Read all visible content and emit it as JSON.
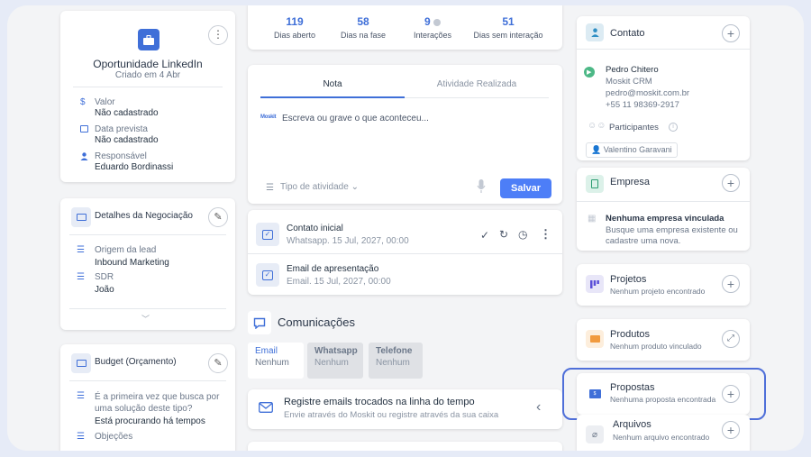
{
  "left": {
    "title": "Oportunidade LinkedIn",
    "created": "Criado em 4 Abr",
    "fields": [
      {
        "icon": "dollar-icon",
        "label": "Valor",
        "value": "Não cadastrado"
      },
      {
        "icon": "calendar-icon",
        "label": "Data prevista",
        "value": "Não cadastrado"
      },
      {
        "icon": "user-icon",
        "label": "Responsável",
        "value": "Eduardo Bordinassi"
      }
    ],
    "details": {
      "title": "Detalhes da Negociação",
      "rows": [
        {
          "label": "Origem da lead",
          "value": "Inbound Marketing"
        },
        {
          "label": "SDR",
          "value": "João"
        }
      ]
    },
    "budget": {
      "title": "Budget (Orçamento)",
      "q1": "É a primeira vez que busca por uma solução deste tipo?",
      "a1": "Está procurando há tempos",
      "q2": "Objeções"
    }
  },
  "stats": [
    {
      "value": "119",
      "label": "Dias aberto"
    },
    {
      "value": "58",
      "label": "Dias na fase"
    },
    {
      "value": "9",
      "label": "Interações"
    },
    {
      "value": "51",
      "label": "Dias sem interação"
    }
  ],
  "note": {
    "tab_note": "Nota",
    "tab_activity": "Atividade Realizada",
    "logo_text": "Moskit",
    "placeholder": "Escreva ou grave o que aconteceu...",
    "activity_type": "Tipo de atividade",
    "save": "Salvar"
  },
  "activities": [
    {
      "title": "Contato inicial",
      "sub": "Whatsapp. 15 Jul, 2027, 00:00"
    },
    {
      "title": "Email de apresentação",
      "sub": "Email. 15 Jul, 2027, 00:00"
    }
  ],
  "comms": {
    "title": "Comunicações",
    "tabs": [
      {
        "name": "Email",
        "value": "Nenhum"
      },
      {
        "name": "Whatsapp",
        "value": "Nenhum"
      },
      {
        "name": "Telefone",
        "value": "Nenhum"
      }
    ],
    "email_title": "Registre emails trocados na linha do tempo",
    "email_sub": "Envie através do Moskit ou registre através da sua caixa"
  },
  "right": {
    "contact": {
      "title": "Contato",
      "name": "Pedro Chitero",
      "company": "Moskit CRM",
      "email": "pedro@moskit.com.br",
      "phone": "+55 11 98369-2917",
      "participants": "Participantes",
      "participant": "Valentino Garavani"
    },
    "company": {
      "title": "Empresa",
      "none": "Nenhuma empresa vinculada",
      "hint": "Busque uma empresa existente ou cadastre uma nova."
    },
    "projects": {
      "title": "Projetos",
      "sub": "Nenhum projeto encontrado"
    },
    "products": {
      "title": "Produtos",
      "sub": "Nenhum produto vinculado"
    },
    "proposals": {
      "title": "Propostas",
      "sub": "Nenhuma proposta encontrada"
    },
    "files": {
      "title": "Arquivos",
      "sub": "Nenhum arquivo encontrado"
    }
  },
  "colors": {
    "accent": "#4d7ef7",
    "highlight": "#4f6fd9",
    "stat": "#3f6fd8"
  }
}
